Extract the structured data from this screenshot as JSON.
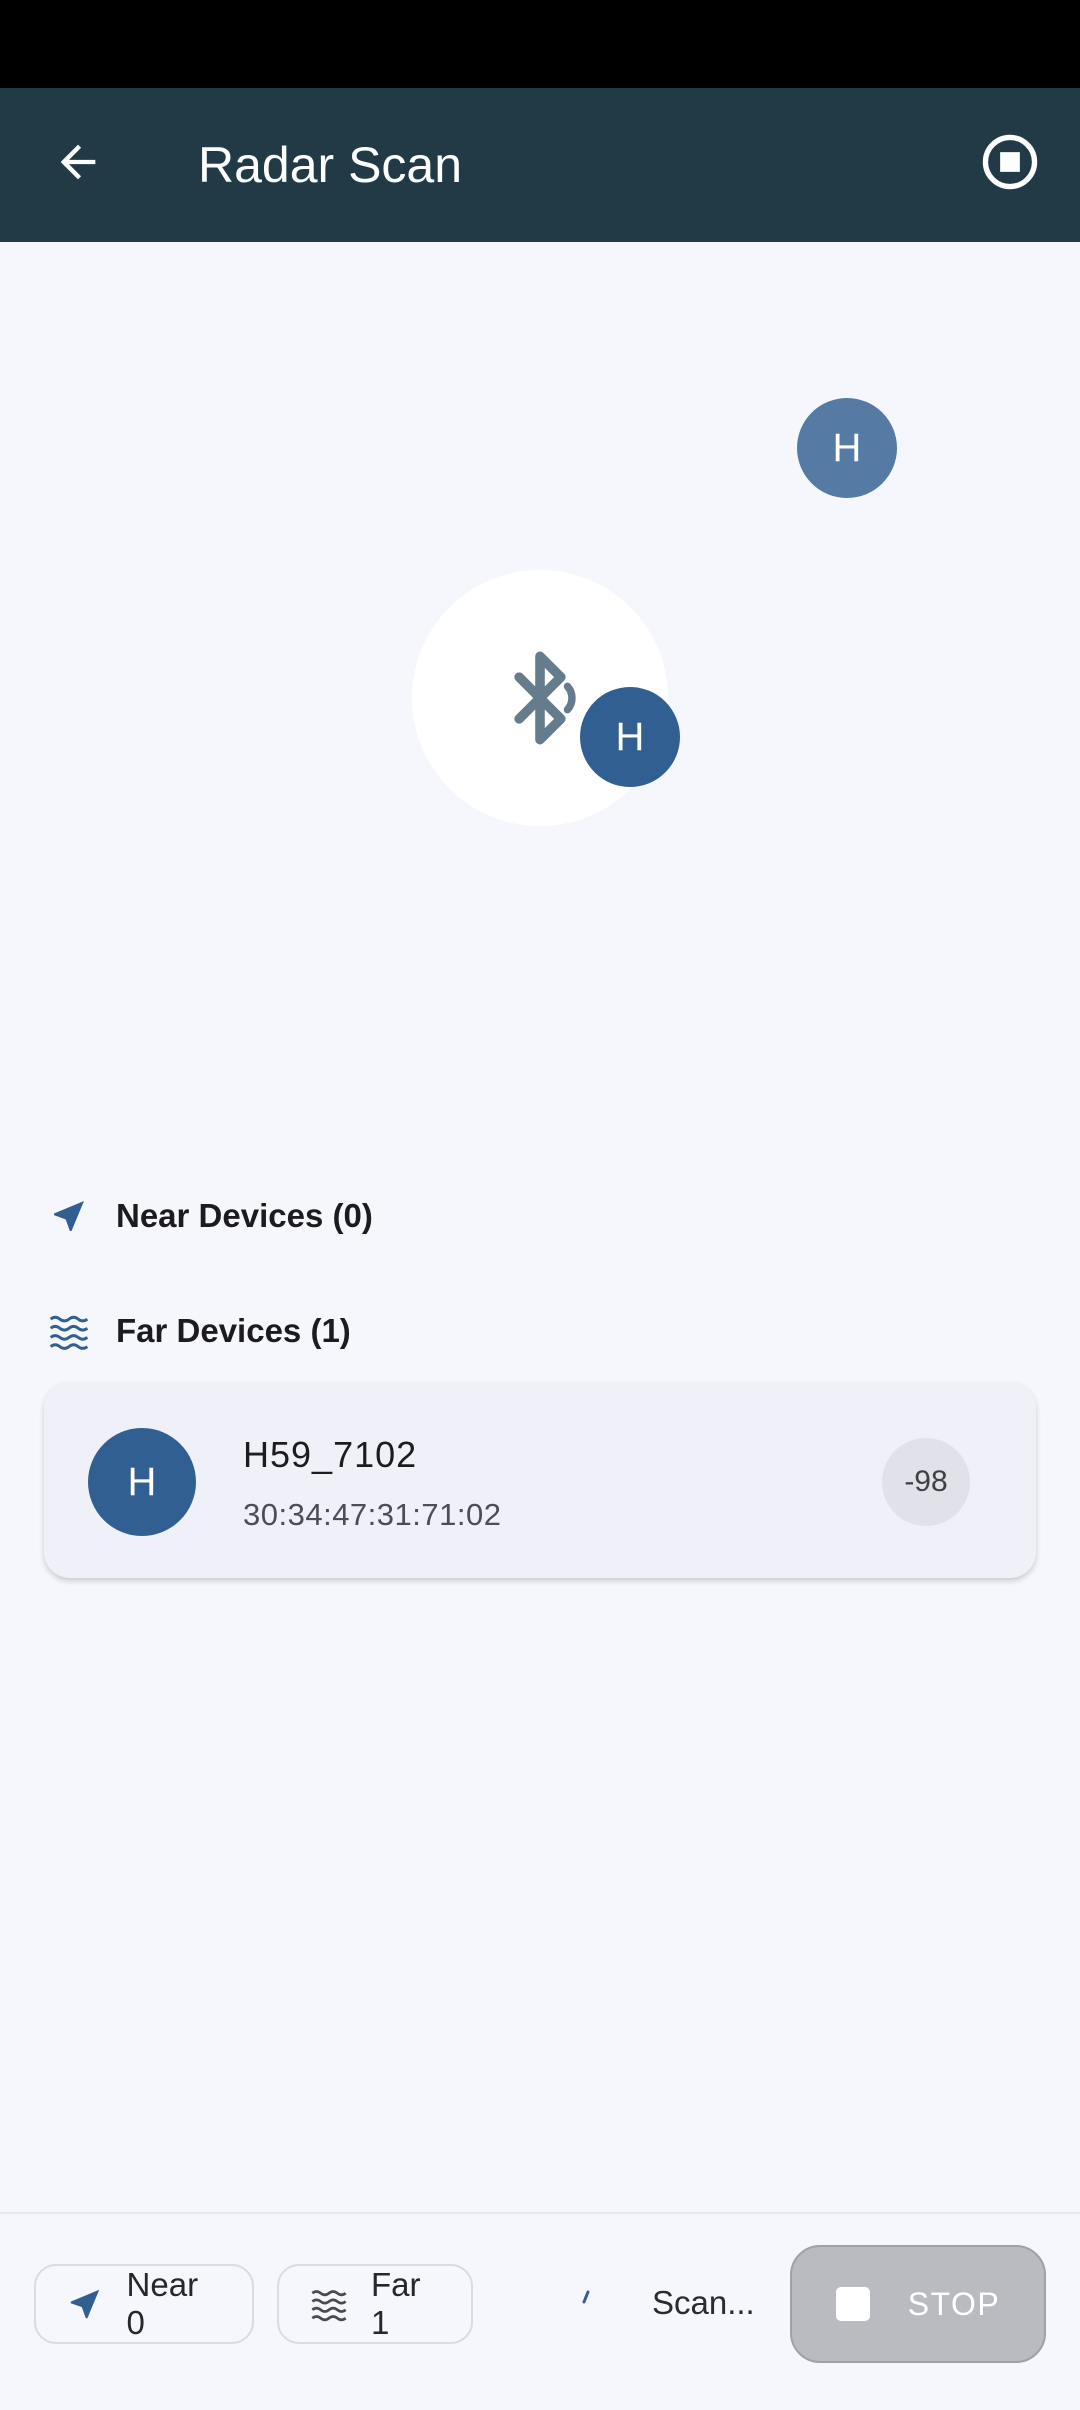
{
  "app_bar": {
    "title": "Radar Scan",
    "back_icon": "arrow-left-icon",
    "stop_icon": "stop-circle-icon",
    "background": "#213a46"
  },
  "radar": {
    "center_icon": "bluetooth-searching-icon",
    "devices": [
      {
        "initial": "H"
      },
      {
        "initial": "H"
      }
    ]
  },
  "sections": {
    "near": {
      "label": "Near Devices (0)",
      "icon": "navigation-arrow-icon"
    },
    "far": {
      "label": "Far Devices (1)",
      "icon": "waves-icon"
    }
  },
  "far_devices": [
    {
      "initial": "H",
      "name": "H59_7102",
      "mac": "30:34:47:31:71:02",
      "rssi": "-98"
    }
  ],
  "bottom_bar": {
    "near_chip": {
      "label": "Near 0",
      "icon": "navigation-arrow-icon"
    },
    "far_chip": {
      "label": "Far 1",
      "icon": "waves-icon"
    },
    "status": "Scan...",
    "stop_button": {
      "label": "STOP",
      "icon": "stop-square-icon"
    }
  },
  "colors": {
    "accent": "#325f91",
    "device_dot_far": "#557aa3",
    "background": "#f6f7fc"
  }
}
